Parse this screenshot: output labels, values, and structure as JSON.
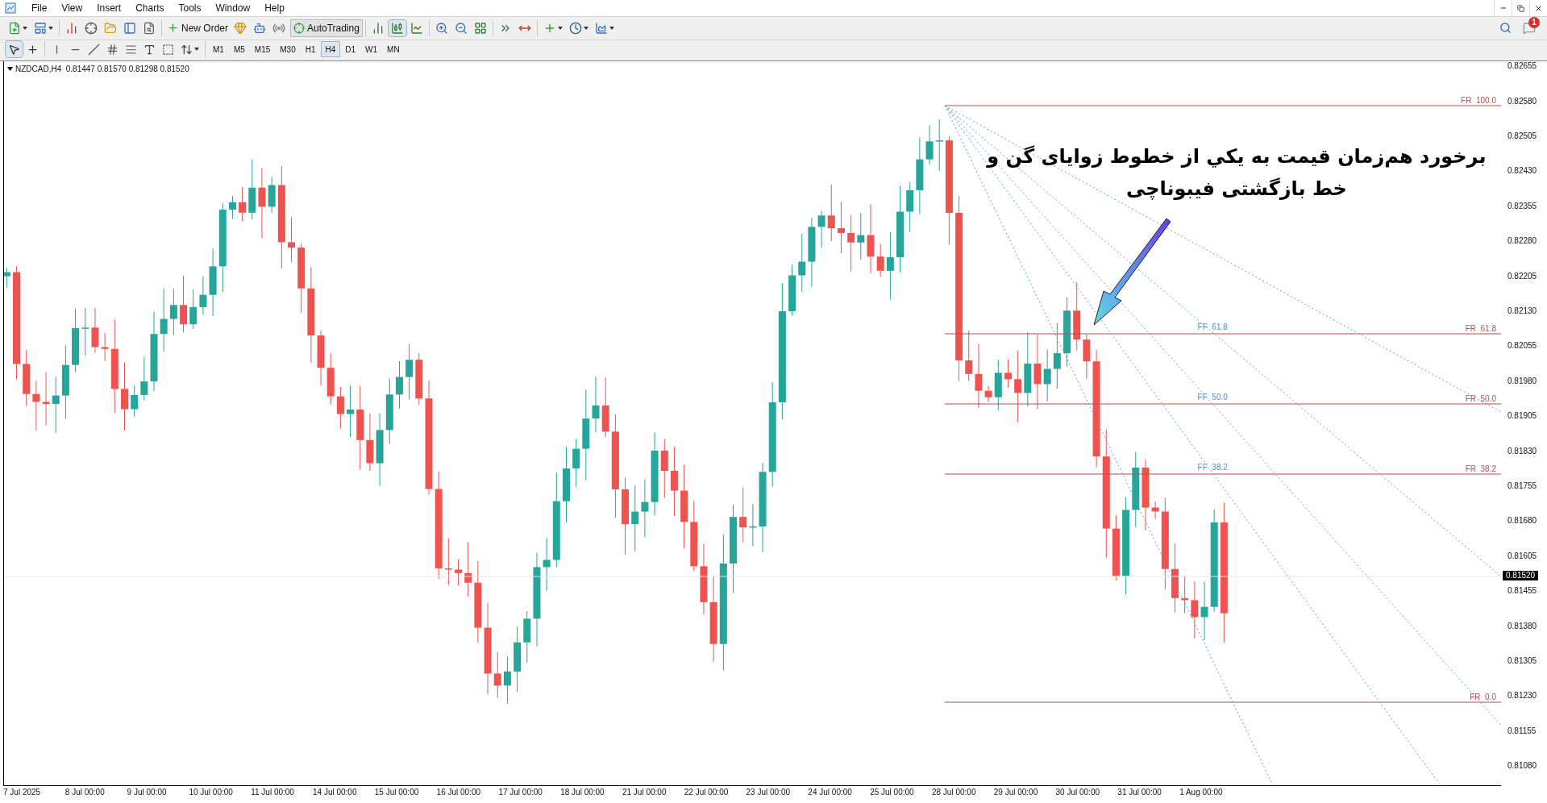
{
  "menu": [
    "File",
    "View",
    "Insert",
    "Charts",
    "Tools",
    "Window",
    "Help"
  ],
  "toolbar": {
    "new_order": "New Order",
    "auto_trading": "AutoTrading",
    "chart_types": [
      {
        "selected": false
      },
      {
        "selected": true
      },
      {
        "selected": false
      }
    ]
  },
  "drawing_tools": [
    {
      "selected": true
    },
    {
      "selected": false
    }
  ],
  "timeframes": [
    {
      "label": "M1",
      "selected": false
    },
    {
      "label": "M5",
      "selected": false
    },
    {
      "label": "M15",
      "selected": false
    },
    {
      "label": "M30",
      "selected": false
    },
    {
      "label": "H1",
      "selected": false
    },
    {
      "label": "H4",
      "selected": true
    },
    {
      "label": "D1",
      "selected": false
    },
    {
      "label": "W1",
      "selected": false
    },
    {
      "label": "MN",
      "selected": false
    }
  ],
  "notifications": {
    "count": "1"
  },
  "chart": {
    "symbol_line": "NZDCAD,H4  0.81447 0.81570 0.81298 0.81520",
    "fib_levels": [
      {
        "right_label": "FR  100.0"
      },
      {
        "right_label": "FR  61.8",
        "fan_label": "FF  61.8"
      },
      {
        "right_label": "FR  50.0",
        "fan_label": "FF  50.0"
      },
      {
        "right_label": "FR  38.2",
        "fan_label": "FF  38.2"
      },
      {
        "right_label": "FR  0.0"
      }
    ],
    "annotation": [
      "برخورد هم‌زمان قیمت به یکي از خطوط زوایای گن و",
      "خط بازگشتی فیبوناچی"
    ],
    "price_labels": [
      "0.82655",
      "0.82580",
      "0.82505",
      "0.82430",
      "0.82355",
      "0.82280",
      "0.82205",
      "0.82130",
      "0.82055",
      "0.81980",
      "0.81905",
      "0.81830",
      "0.81755",
      "0.81680",
      "0.81605",
      "0.81455",
      "0.81380",
      "0.81305",
      "0.81230",
      "0.81155",
      "0.81080"
    ],
    "current_price": "0.81520",
    "time_labels": [
      "7 Jul 2025",
      "8 Jul 00:00",
      "9 Jul 00:00",
      "10 Jul 00:00",
      "11 Jul 00:00",
      "14 Jul 00:00",
      "15 Jul 00:00",
      "16 Jul 00:00",
      "17 Jul 00:00",
      "18 Jul 00:00",
      "21 Jul 00:00",
      "22 Jul 00:00",
      "23 Jul 00:00",
      "24 Jul 00:00",
      "25 Jul 00:00",
      "28 Jul 00:00",
      "29 Jul 00:00",
      "30 Jul 00:00",
      "31 Jul 00:00",
      "1 Aug 00:00"
    ]
  }
}
